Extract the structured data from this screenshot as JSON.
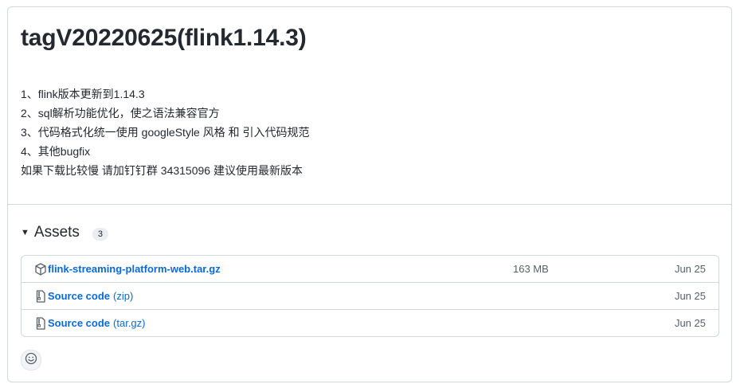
{
  "release": {
    "title": "tagV20220625(flink1.14.3)",
    "notes": [
      "1、flink版本更新到1.14.3",
      "2、sql解析功能优化，使之语法兼容官方",
      "3、代码格式化统一使用 googleStyle 风格 和 引入代码规范",
      "4、其他bugfix",
      "如果下载比较慢 请加钉钉群 34315096 建议使用最新版本"
    ]
  },
  "assets": {
    "title": "Assets",
    "count": "3",
    "items": [
      {
        "icon": "package-icon",
        "name": "flink-streaming-platform-web.tar.gz",
        "suffix": "",
        "size": "163 MB",
        "date": "Jun 25"
      },
      {
        "icon": "file-zip-icon",
        "name": "Source code",
        "suffix": "(zip)",
        "size": "",
        "date": "Jun 25"
      },
      {
        "icon": "file-zip-icon",
        "name": "Source code",
        "suffix": "(tar.gz)",
        "size": "",
        "date": "Jun 25"
      }
    ]
  },
  "colors": {
    "link": "#0969da",
    "border": "#d0d7de",
    "text": "#24292f",
    "muted": "#57606a"
  },
  "reaction_icon": "smiley-icon"
}
